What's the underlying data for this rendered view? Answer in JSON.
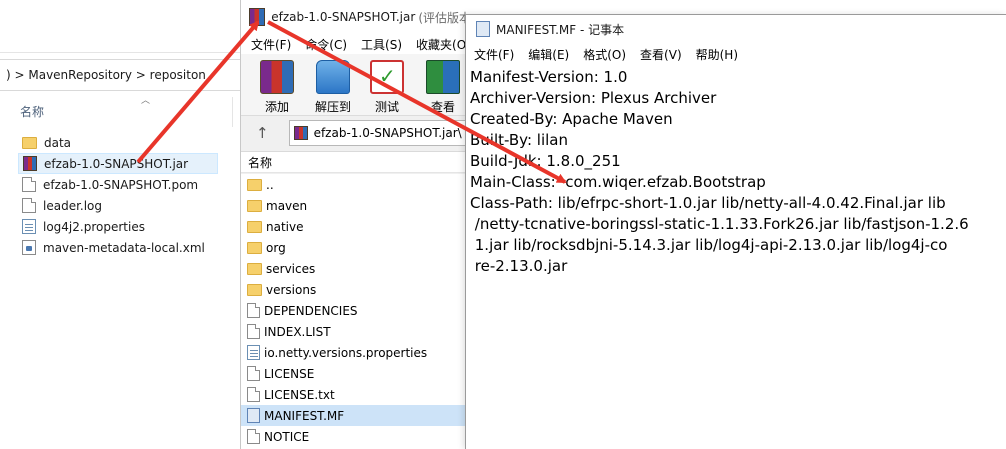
{
  "explorer": {
    "breadcrumb": ") > MavenRepository > repositon",
    "column_name": "名称",
    "files": [
      {
        "name": "data",
        "icon": "folder-icon"
      },
      {
        "name": "efzab-1.0-SNAPSHOT.jar",
        "icon": "jar-icon",
        "selected": true
      },
      {
        "name": "efzab-1.0-SNAPSHOT.pom",
        "icon": "file-icon"
      },
      {
        "name": "leader.log",
        "icon": "file-icon"
      },
      {
        "name": "log4j2.properties",
        "icon": "properties-icon"
      },
      {
        "name": "maven-metadata-local.xml",
        "icon": "xml-icon"
      }
    ]
  },
  "winrar": {
    "title": "efzab-1.0-SNAPSHOT.jar",
    "title_suffix": "(评估版本",
    "menu": [
      "文件(F)",
      "命令(C)",
      "工具(S)",
      "收藏夹(O)"
    ],
    "toolbar": {
      "add": "添加",
      "extract": "解压到",
      "test": "测试",
      "view": "查看"
    },
    "up_icon": "↑",
    "path": "efzab-1.0-SNAPSHOT.jar\\",
    "column_name": "名称",
    "entries": [
      {
        "name": "..",
        "icon": "folder-icon"
      },
      {
        "name": "maven",
        "icon": "folder-icon"
      },
      {
        "name": "native",
        "icon": "folder-icon"
      },
      {
        "name": "org",
        "icon": "folder-icon"
      },
      {
        "name": "services",
        "icon": "folder-icon"
      },
      {
        "name": "versions",
        "icon": "folder-icon"
      },
      {
        "name": "DEPENDENCIES",
        "icon": "file-icon"
      },
      {
        "name": "INDEX.LIST",
        "icon": "file-icon"
      },
      {
        "name": "io.netty.versions.properties",
        "icon": "properties-icon"
      },
      {
        "name": "LICENSE",
        "icon": "file-icon"
      },
      {
        "name": "LICENSE.txt",
        "icon": "file-icon"
      },
      {
        "name": "MANIFEST.MF",
        "icon": "manifest-icon",
        "selected": true
      },
      {
        "name": "NOTICE",
        "icon": "file-icon"
      }
    ]
  },
  "notepad": {
    "title": "MANIFEST.MF - 记事本",
    "menu": [
      "文件(F)",
      "编辑(E)",
      "格式(O)",
      "查看(V)",
      "帮助(H)"
    ],
    "lines": [
      "Manifest-Version: 1.0",
      "Archiver-Version: Plexus Archiver",
      "Created-By: Apache Maven",
      "Built-By: lilan",
      "Build-Jdk: 1.8.0_251",
      "Main-Class:  com.wiqer.efzab.Bootstrap",
      "Class-Path: lib/efrpc-short-1.0.jar lib/netty-all-4.0.42.Final.jar lib",
      " /netty-tcnative-boringssl-static-1.1.33.Fork26.jar lib/fastjson-1.2.6",
      " 1.jar lib/rocksdbjni-5.14.3.jar lib/log4j-api-2.13.0.jar lib/log4j-co",
      " re-2.13.0.jar"
    ]
  },
  "colors": {
    "arrow": "#e8352a",
    "selection": "#cde3f8"
  }
}
